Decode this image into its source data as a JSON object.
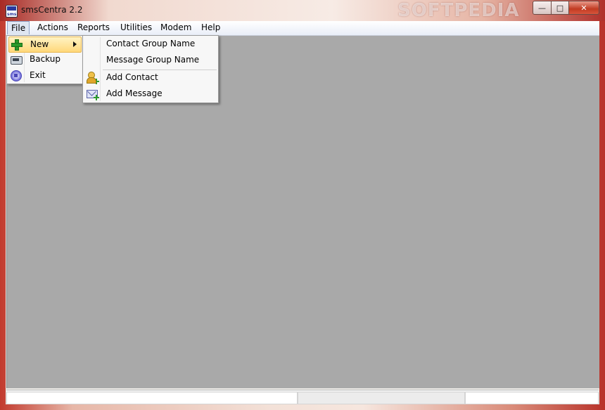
{
  "window": {
    "title": "smsCentra 2.2",
    "app_icon_text": "sms",
    "watermark": "SOFTPEDIA",
    "minimize_glyph": "—",
    "maximize_glyph": "□",
    "close_glyph": "✕"
  },
  "menubar": {
    "items": [
      {
        "label": "File"
      },
      {
        "label": "Actions"
      },
      {
        "label": "Reports"
      },
      {
        "label": "Utilities"
      },
      {
        "label": "Modem"
      },
      {
        "label": "Help"
      }
    ],
    "active": "File"
  },
  "file_menu": {
    "items": [
      {
        "label": "New",
        "icon": "plus-icon",
        "has_submenu": true,
        "highlighted": true
      },
      {
        "label": "Backup",
        "icon": "backup-icon"
      },
      {
        "label": "Exit",
        "icon": "exit-icon"
      }
    ]
  },
  "new_submenu": {
    "items": [
      {
        "label": "Contact Group Name"
      },
      {
        "label": "Message Group Name"
      },
      {
        "label": "Add Contact",
        "icon": "add-contact-icon"
      },
      {
        "label": "Add Message",
        "icon": "add-message-icon"
      }
    ]
  },
  "colors": {
    "desktop": "#a9a9a9",
    "highlight": "#ffd87a"
  }
}
